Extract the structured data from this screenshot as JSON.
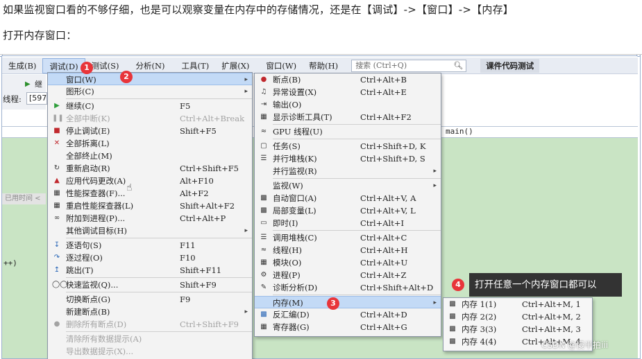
{
  "article": {
    "line1": "如果监视窗口看的不够仔细，也是可以观察变量在内存中的存储情况，还是在【调试】->【窗口】->【内存】",
    "line2": "打开内存窗口："
  },
  "menubar": {
    "items": [
      "生成(B)",
      "调试(D)",
      "测试(S)",
      "分析(N)",
      "工具(T)",
      "扩展(X)",
      "窗口(W)",
      "帮助(H)"
    ],
    "search_placeholder": "搜索 (Ctrl+Q)",
    "course_button": "课件代码测试"
  },
  "ide": {
    "continue_partial": "继",
    "thread_label": "线程:",
    "thread_value": "[597",
    "used_time": "已用时间 <",
    "code_pp": "++)",
    "code_main": "main()"
  },
  "debug_menu": [
    {
      "label": "窗口(W)",
      "shortcut": "",
      "arrow": true,
      "icon": "",
      "disabled": false,
      "highlight": true
    },
    {
      "label": "图形(C)",
      "shortcut": "",
      "arrow": true,
      "icon": "",
      "disabled": false
    },
    {
      "sep": true
    },
    {
      "label": "继续(C)",
      "shortcut": "F5",
      "icon": "play-icon",
      "disabled": false
    },
    {
      "label": "全部中断(K)",
      "shortcut": "Ctrl+Alt+Break",
      "icon": "pause-icon",
      "disabled": true
    },
    {
      "label": "停止调试(E)",
      "shortcut": "Shift+F5",
      "icon": "stop-icon",
      "disabled": false
    },
    {
      "label": "全部拆离(L)",
      "shortcut": "",
      "icon": "detach-icon",
      "disabled": false
    },
    {
      "label": "全部终止(M)",
      "shortcut": "",
      "icon": "",
      "disabled": false
    },
    {
      "label": "重新启动(R)",
      "shortcut": "Ctrl+Shift+F5",
      "icon": "restart-icon",
      "disabled": false
    },
    {
      "label": "应用代码更改(A)",
      "shortcut": "Alt+F10",
      "icon": "flame-icon",
      "disabled": false
    },
    {
      "label": "性能探查器(F)...",
      "shortcut": "Alt+F2",
      "icon": "profiler-icon",
      "disabled": false
    },
    {
      "label": "重启性能探查器(L)",
      "shortcut": "Shift+Alt+F2",
      "icon": "profiler-restart-icon",
      "disabled": false
    },
    {
      "label": "附加到进程(P)...",
      "shortcut": "Ctrl+Alt+P",
      "icon": "attach-icon",
      "disabled": false
    },
    {
      "label": "其他调试目标(H)",
      "shortcut": "",
      "arrow": true,
      "icon": "",
      "disabled": false
    },
    {
      "sep": true
    },
    {
      "label": "逐语句(S)",
      "shortcut": "F11",
      "icon": "step-into-icon",
      "disabled": false
    },
    {
      "label": "逐过程(O)",
      "shortcut": "F10",
      "icon": "step-over-icon",
      "disabled": false
    },
    {
      "label": "跳出(T)",
      "shortcut": "Shift+F11",
      "icon": "step-out-icon",
      "disabled": false
    },
    {
      "sep": true
    },
    {
      "label": "快速监视(Q)...",
      "shortcut": "Shift+F9",
      "icon": "glasses-icon",
      "disabled": false
    },
    {
      "sep": true
    },
    {
      "label": "切换断点(G)",
      "shortcut": "F9",
      "icon": "",
      "disabled": false
    },
    {
      "label": "新建断点(B)",
      "shortcut": "",
      "arrow": true,
      "icon": "",
      "disabled": false
    },
    {
      "label": "删除所有断点(D)",
      "shortcut": "Ctrl+Shift+F9",
      "icon": "delete-breakpoints-icon",
      "disabled": true
    },
    {
      "sep": true
    },
    {
      "label": "清除所有数据提示(A)",
      "shortcut": "",
      "icon": "",
      "disabled": true
    },
    {
      "label": "导出数据提示(X)...",
      "shortcut": "",
      "icon": "",
      "disabled": true
    }
  ],
  "window_menu": [
    {
      "label": "断点(B)",
      "shortcut": "Ctrl+Alt+B",
      "icon": "breakpoint-icon"
    },
    {
      "label": "异常设置(X)",
      "shortcut": "Ctrl+Alt+E",
      "icon": "exception-icon"
    },
    {
      "label": "输出(O)",
      "shortcut": "",
      "icon": "output-icon"
    },
    {
      "label": "显示诊断工具(T)",
      "shortcut": "Ctrl+Alt+F2",
      "icon": "diagnostics-icon"
    },
    {
      "sep": true
    },
    {
      "label": "GPU 线程(U)",
      "shortcut": "",
      "icon": "gpu-threads-icon"
    },
    {
      "sep": true
    },
    {
      "label": "任务(S)",
      "shortcut": "Ctrl+Shift+D, K",
      "icon": "tasks-icon"
    },
    {
      "label": "并行堆栈(K)",
      "shortcut": "Ctrl+Shift+D, S",
      "icon": "parallel-stacks-icon"
    },
    {
      "label": "并行监视(R)",
      "shortcut": "",
      "arrow": true,
      "icon": ""
    },
    {
      "sep": true
    },
    {
      "label": "监视(W)",
      "shortcut": "",
      "arrow": true,
      "icon": ""
    },
    {
      "label": "自动窗口(A)",
      "shortcut": "Ctrl+Alt+V, A",
      "icon": "autos-icon"
    },
    {
      "label": "局部变量(L)",
      "shortcut": "Ctrl+Alt+V, L",
      "icon": "locals-icon"
    },
    {
      "label": "即时(I)",
      "shortcut": "Ctrl+Alt+I",
      "icon": "immediate-icon"
    },
    {
      "sep": true
    },
    {
      "label": "调用堆栈(C)",
      "shortcut": "Ctrl+Alt+C",
      "icon": "call-stack-icon"
    },
    {
      "label": "线程(H)",
      "shortcut": "Ctrl+Alt+H",
      "icon": "threads-icon"
    },
    {
      "label": "模块(O)",
      "shortcut": "Ctrl+Alt+U",
      "icon": "modules-icon"
    },
    {
      "label": "进程(P)",
      "shortcut": "Ctrl+Alt+Z",
      "icon": "processes-icon"
    },
    {
      "label": "诊断分析(D)",
      "shortcut": "Ctrl+Shift+Alt+D",
      "icon": "diagnostic-analysis-icon"
    },
    {
      "sep": true
    },
    {
      "label": "内存(M)",
      "shortcut": "",
      "arrow": true,
      "icon": "",
      "highlight": true
    },
    {
      "label": "反汇编(D)",
      "shortcut": "Ctrl+Alt+D",
      "icon": "disassembly-icon"
    },
    {
      "label": "寄存器(G)",
      "shortcut": "Ctrl+Alt+G",
      "icon": "registers-icon"
    }
  ],
  "memory_menu": [
    {
      "label": "内存 1(1)",
      "shortcut": "Ctrl+Alt+M, 1",
      "icon": "memory-chip-icon"
    },
    {
      "label": "内存 2(2)",
      "shortcut": "Ctrl+Alt+M, 2",
      "icon": "memory-chip-icon"
    },
    {
      "label": "内存 3(3)",
      "shortcut": "Ctrl+Alt+M, 3",
      "icon": "memory-chip-icon"
    },
    {
      "label": "内存 4(4)",
      "shortcut": "Ctrl+Alt+M, 4",
      "icon": "memory-chip-icon"
    }
  ],
  "annotations": {
    "badge1": "1",
    "badge2": "2",
    "badge3": "3",
    "badge4": "4",
    "tooltip": "打开任意一个内存窗口都可以"
  },
  "watermark": "CSDN @慢半拍iii",
  "colors": {
    "badge": "#e8353a",
    "highlight": "#c3daf6",
    "editor_green": "#c9e4c4"
  }
}
